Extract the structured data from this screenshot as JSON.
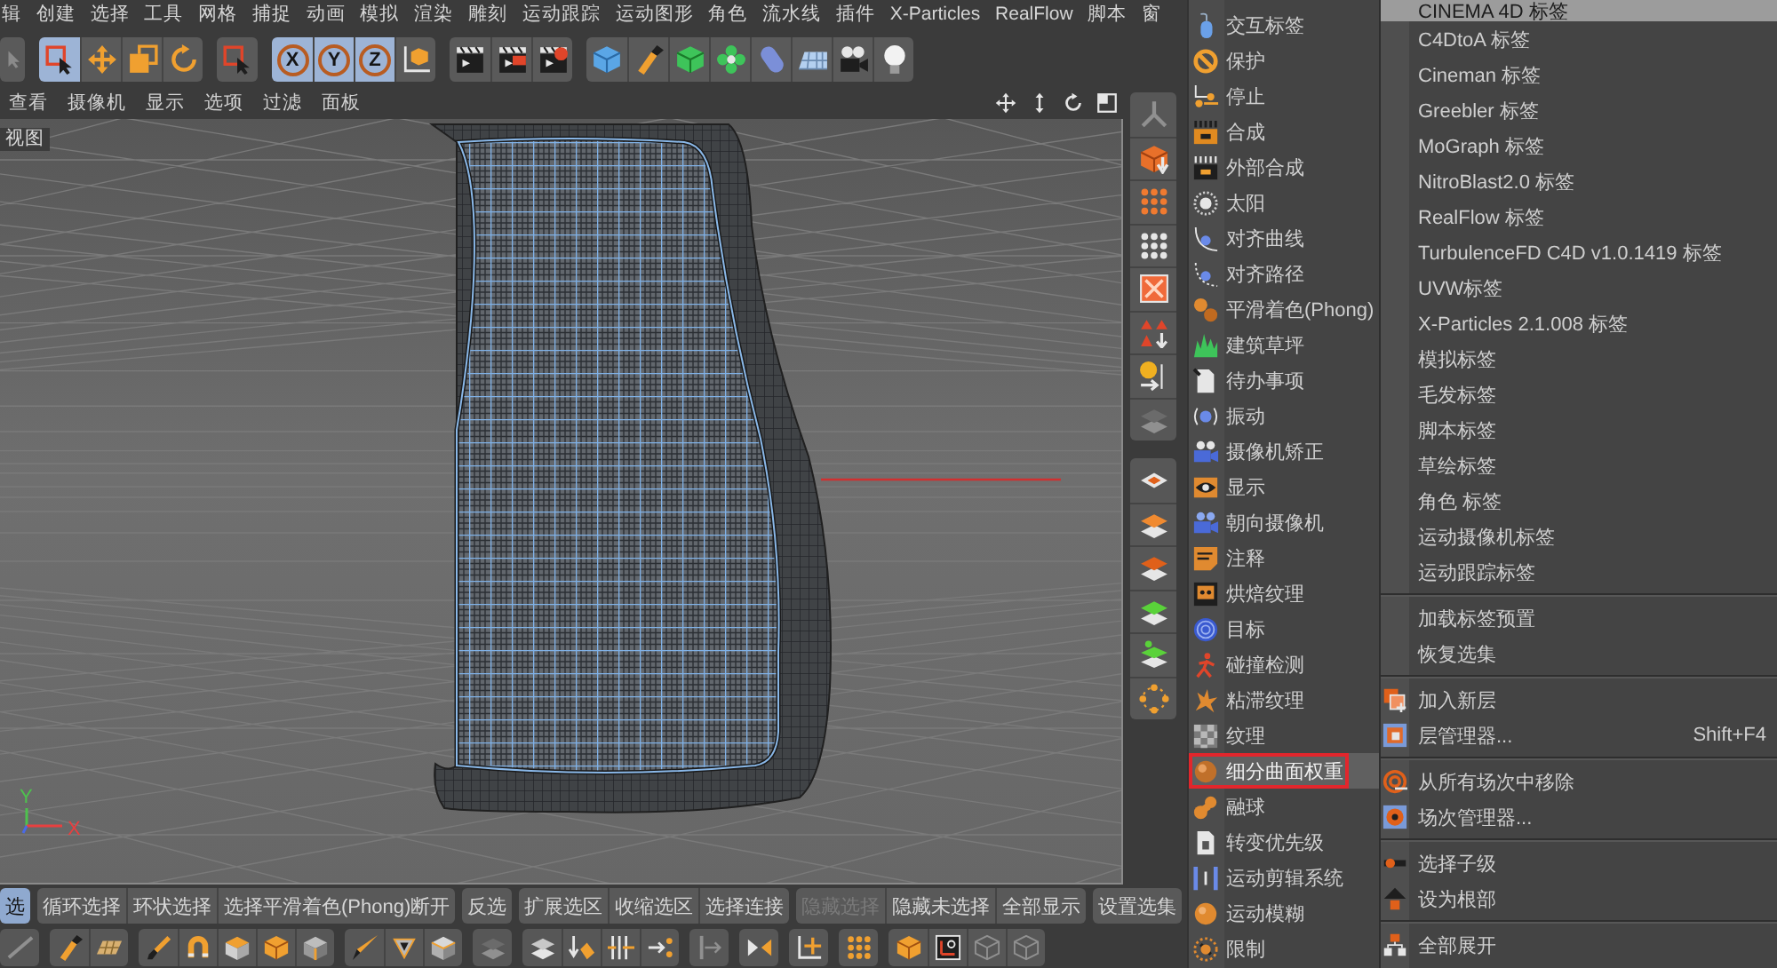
{
  "menu_bar": {
    "items": [
      "辑",
      "创建",
      "选择",
      "工具",
      "网格",
      "捕捉",
      "动画",
      "模拟",
      "渲染",
      "雕刻",
      "运动跟踪",
      "运动图形",
      "角色",
      "流水线",
      "插件",
      "X-Particles",
      "RealFlow",
      "脚本",
      "窗"
    ]
  },
  "toolbar": {
    "groups": [
      [
        {
          "selected": false
        }
      ],
      [
        {
          "selected": true
        },
        {
          "selected": false
        },
        {
          "selected": false
        },
        {
          "selected": false
        }
      ],
      [
        {
          "selected": false
        }
      ],
      [
        {
          "label": "X",
          "selected": true
        },
        {
          "label": "Y",
          "selected": true
        },
        {
          "label": "Z",
          "selected": true
        },
        {
          "selected": false
        }
      ],
      [
        {
          "selected": false
        },
        {
          "selected": false
        },
        {
          "selected": false
        }
      ],
      [
        {
          "selected": false
        },
        {
          "selected": false
        },
        {
          "selected": false
        },
        {
          "selected": false
        },
        {
          "selected": false
        },
        {
          "selected": false
        },
        {
          "selected": false
        },
        {
          "selected": false
        }
      ]
    ]
  },
  "viewport": {
    "menu": [
      "查看",
      "摄像机",
      "显示",
      "选项",
      "过滤",
      "面板"
    ],
    "label": "视图",
    "axis_labels": [
      "Y",
      "X"
    ]
  },
  "tool_palette": {
    "groups": [
      [
        {
          "disabled": true
        },
        {
          "disabled": false
        },
        {
          "disabled": false
        },
        {
          "disabled": false
        },
        {
          "disabled": false
        },
        {
          "disabled": false
        },
        {
          "disabled": false
        },
        {
          "disabled": true
        }
      ],
      [
        {
          "disabled": false
        },
        {
          "disabled": false
        },
        {
          "disabled": false
        },
        {
          "disabled": false
        },
        {
          "disabled": false
        },
        {
          "disabled": false
        }
      ]
    ]
  },
  "selection_toolbar": {
    "groups": [
      [
        {
          "label": "选",
          "selected": true,
          "disabled": false
        }
      ],
      [
        {
          "label": "循环选择",
          "selected": false,
          "disabled": false
        },
        {
          "label": "环状选择",
          "selected": false,
          "disabled": false
        },
        {
          "label": "选择平滑着色(Phong)断开",
          "selected": false,
          "disabled": false
        }
      ],
      [
        {
          "label": "反选",
          "selected": false,
          "disabled": false
        }
      ],
      [
        {
          "label": "扩展选区",
          "selected": false,
          "disabled": false
        },
        {
          "label": "收缩选区",
          "selected": false,
          "disabled": false
        },
        {
          "label": "选择连接",
          "selected": false,
          "disabled": false
        }
      ],
      [
        {
          "label": "隐藏选择",
          "selected": false,
          "disabled": true
        },
        {
          "label": "隐藏未选择",
          "selected": false,
          "disabled": false
        },
        {
          "label": "全部显示",
          "selected": false,
          "disabled": false
        }
      ],
      [
        {
          "label": "设置选集",
          "selected": false,
          "disabled": false
        }
      ]
    ]
  },
  "modeling_toolbar": {
    "groups": [
      [
        {
          "disabled": true
        }
      ],
      [
        {
          "disabled": false
        },
        {
          "disabled": false
        }
      ],
      [
        {
          "disabled": false
        },
        {
          "disabled": false
        },
        {
          "disabled": false
        },
        {
          "disabled": false
        },
        {
          "disabled": false
        }
      ],
      [
        {
          "disabled": false
        },
        {
          "disabled": false
        },
        {
          "disabled": false
        }
      ],
      [
        {
          "disabled": true
        }
      ],
      [
        {
          "disabled": false
        },
        {
          "disabled": false
        },
        {
          "disabled": false
        },
        {
          "disabled": false
        }
      ],
      [
        {
          "disabled": true
        }
      ],
      [
        {
          "disabled": false
        }
      ],
      [
        {
          "disabled": false
        }
      ],
      [
        {
          "disabled": false
        }
      ],
      [
        {
          "disabled": false
        },
        {
          "disabled": false
        },
        {
          "disabled": true
        },
        {
          "disabled": true
        }
      ]
    ]
  },
  "tag_submenu": {
    "items": [
      {
        "label": "交互标签",
        "selected": false
      },
      {
        "label": "保护",
        "selected": false
      },
      {
        "label": "停止",
        "selected": false
      },
      {
        "label": "合成",
        "selected": false
      },
      {
        "label": "外部合成",
        "selected": false
      },
      {
        "label": "太阳",
        "selected": false
      },
      {
        "label": "对齐曲线",
        "selected": false
      },
      {
        "label": "对齐路径",
        "selected": false
      },
      {
        "label": "平滑着色(Phong)",
        "selected": false
      },
      {
        "label": "建筑草坪",
        "selected": false
      },
      {
        "label": "待办事项",
        "selected": false
      },
      {
        "label": "振动",
        "selected": false
      },
      {
        "label": "摄像机矫正",
        "selected": false
      },
      {
        "label": "显示",
        "selected": false
      },
      {
        "label": "朝向摄像机",
        "selected": false
      },
      {
        "label": "注释",
        "selected": false
      },
      {
        "label": "烘焙纹理",
        "selected": false
      },
      {
        "label": "目标",
        "selected": false
      },
      {
        "label": "碰撞检测",
        "selected": false
      },
      {
        "label": "粘滞纹理",
        "selected": false
      },
      {
        "label": "纹理",
        "selected": false
      },
      {
        "label": "细分曲面权重",
        "selected": true
      },
      {
        "label": "融球",
        "selected": false
      },
      {
        "label": "转变优先级",
        "selected": false
      },
      {
        "label": "运动剪辑系统",
        "selected": false
      },
      {
        "label": "运动模糊",
        "selected": false
      },
      {
        "label": "限制",
        "selected": false
      }
    ]
  },
  "context_menu": {
    "sections": [
      {
        "items": [
          {
            "label": "CINEMA 4D 标签",
            "selected": true
          },
          {
            "label": "C4DtoA 标签",
            "selected": false
          },
          {
            "label": "Cineman 标签",
            "selected": false
          },
          {
            "label": "Greebler 标签",
            "selected": false
          },
          {
            "label": "MoGraph 标签",
            "selected": false
          },
          {
            "label": "NitroBlast2.0 标签",
            "selected": false
          },
          {
            "label": "RealFlow 标签",
            "selected": false
          },
          {
            "label": "TurbulenceFD C4D v1.0.1419 标签",
            "selected": false
          },
          {
            "label": "UVW标签",
            "selected": false
          },
          {
            "label": "X-Particles 2.1.008 标签",
            "selected": false
          },
          {
            "label": "模拟标签",
            "selected": false
          },
          {
            "label": "毛发标签",
            "selected": false
          },
          {
            "label": "脚本标签",
            "selected": false
          },
          {
            "label": "草绘标签",
            "selected": false
          },
          {
            "label": "角色 标签",
            "selected": false
          },
          {
            "label": "运动摄像机标签",
            "selected": false
          },
          {
            "label": "运动跟踪标签",
            "selected": false
          }
        ]
      },
      {
        "items": [
          {
            "label": "加载标签预置",
            "selected": false
          },
          {
            "label": "恢复选集",
            "selected": false
          }
        ]
      },
      {
        "items": [
          {
            "label": "加入新层",
            "selected": false
          },
          {
            "label": "层管理器...",
            "shortcut": "Shift+F4",
            "selected": false
          }
        ]
      },
      {
        "items": [
          {
            "label": "从所有场次中移除",
            "selected": false
          },
          {
            "label": "场次管理器...",
            "selected": false
          }
        ]
      },
      {
        "items": [
          {
            "label": "选择子级",
            "selected": false
          },
          {
            "label": "设为根部",
            "selected": false
          }
        ]
      },
      {
        "items": [
          {
            "label": "全部展开",
            "selected": false
          }
        ]
      }
    ]
  }
}
